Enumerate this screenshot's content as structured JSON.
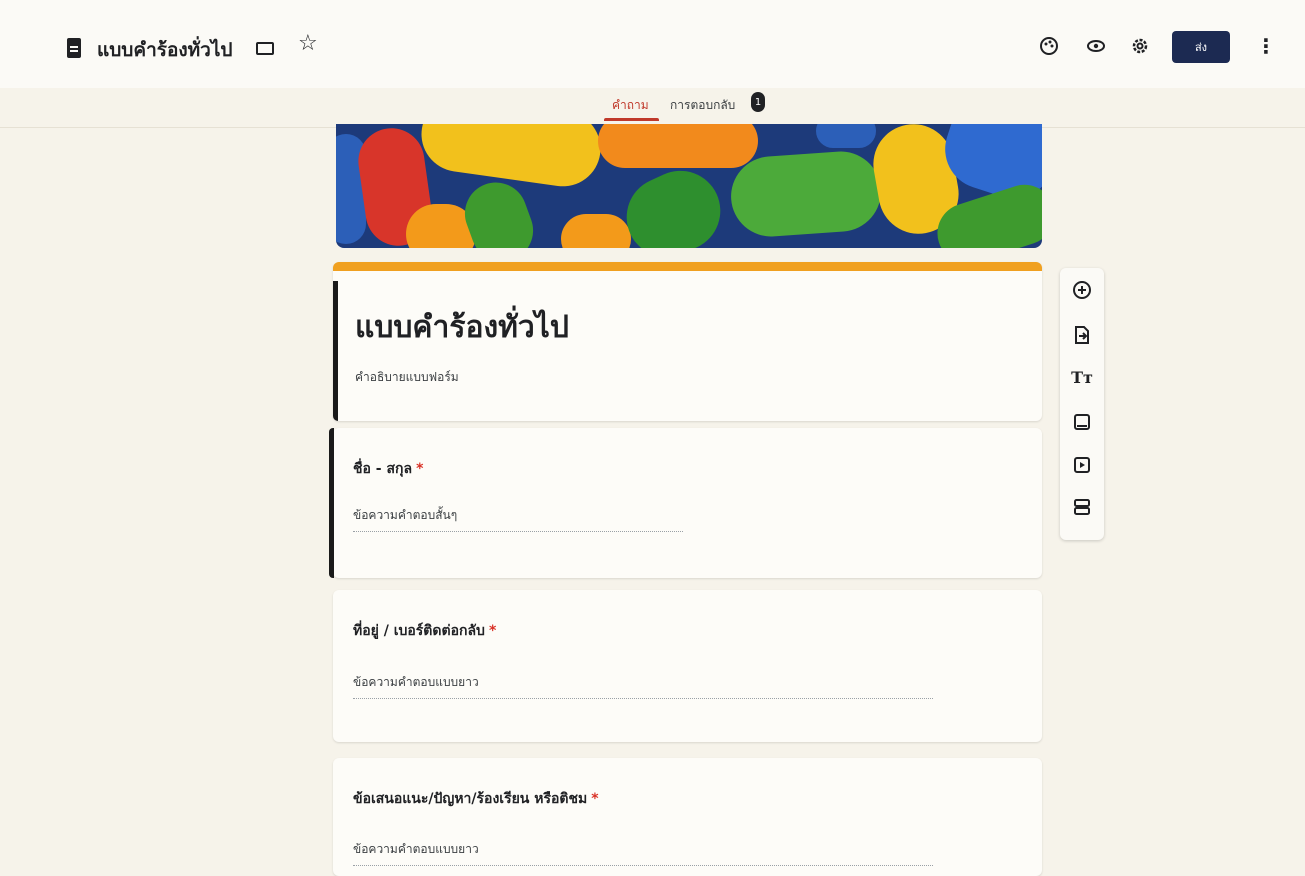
{
  "header": {
    "title": "แบบคำร้องทั่วไป",
    "send_label": "ส่ง"
  },
  "tabs": [
    {
      "label": "คำถาม",
      "active": true
    },
    {
      "label": "การตอบกลับ",
      "active": false
    }
  ],
  "responses_badge": "1",
  "form": {
    "title": "แบบคำร้องทั่วไป",
    "description": "คำอธิบายแบบฟอร์ม"
  },
  "questions": [
    {
      "title": "ชื่อ - สกุล",
      "required": "*",
      "answer_placeholder": "ข้อความคำตอบสั้นๆ"
    },
    {
      "title": "ที่อยู่ / เบอร์ติดต่อกลับ",
      "required": "*",
      "answer_placeholder": "ข้อความคำตอบแบบยาว"
    },
    {
      "title": "ข้อเสนอแนะ/ปัญหา/ร้องเรียน หรือติชม",
      "required": "*",
      "answer_placeholder": "ข้อความคำตอบแบบยาว"
    }
  ],
  "icons": {
    "topbar": [
      "form-doc-icon",
      "folder-icon",
      "star-icon",
      "palette-icon",
      "preview-eye-icon",
      "settings-gear-icon",
      "more-vert-icon"
    ],
    "toolbar": [
      "add-question-icon",
      "import-questions-icon",
      "add-title-icon",
      "add-image-icon",
      "add-video-icon",
      "add-section-icon"
    ]
  },
  "colors": {
    "accent": "#c0392b",
    "send_button": "#1c2a52",
    "theme_bar": "#f0a020",
    "required": "#d93025"
  }
}
